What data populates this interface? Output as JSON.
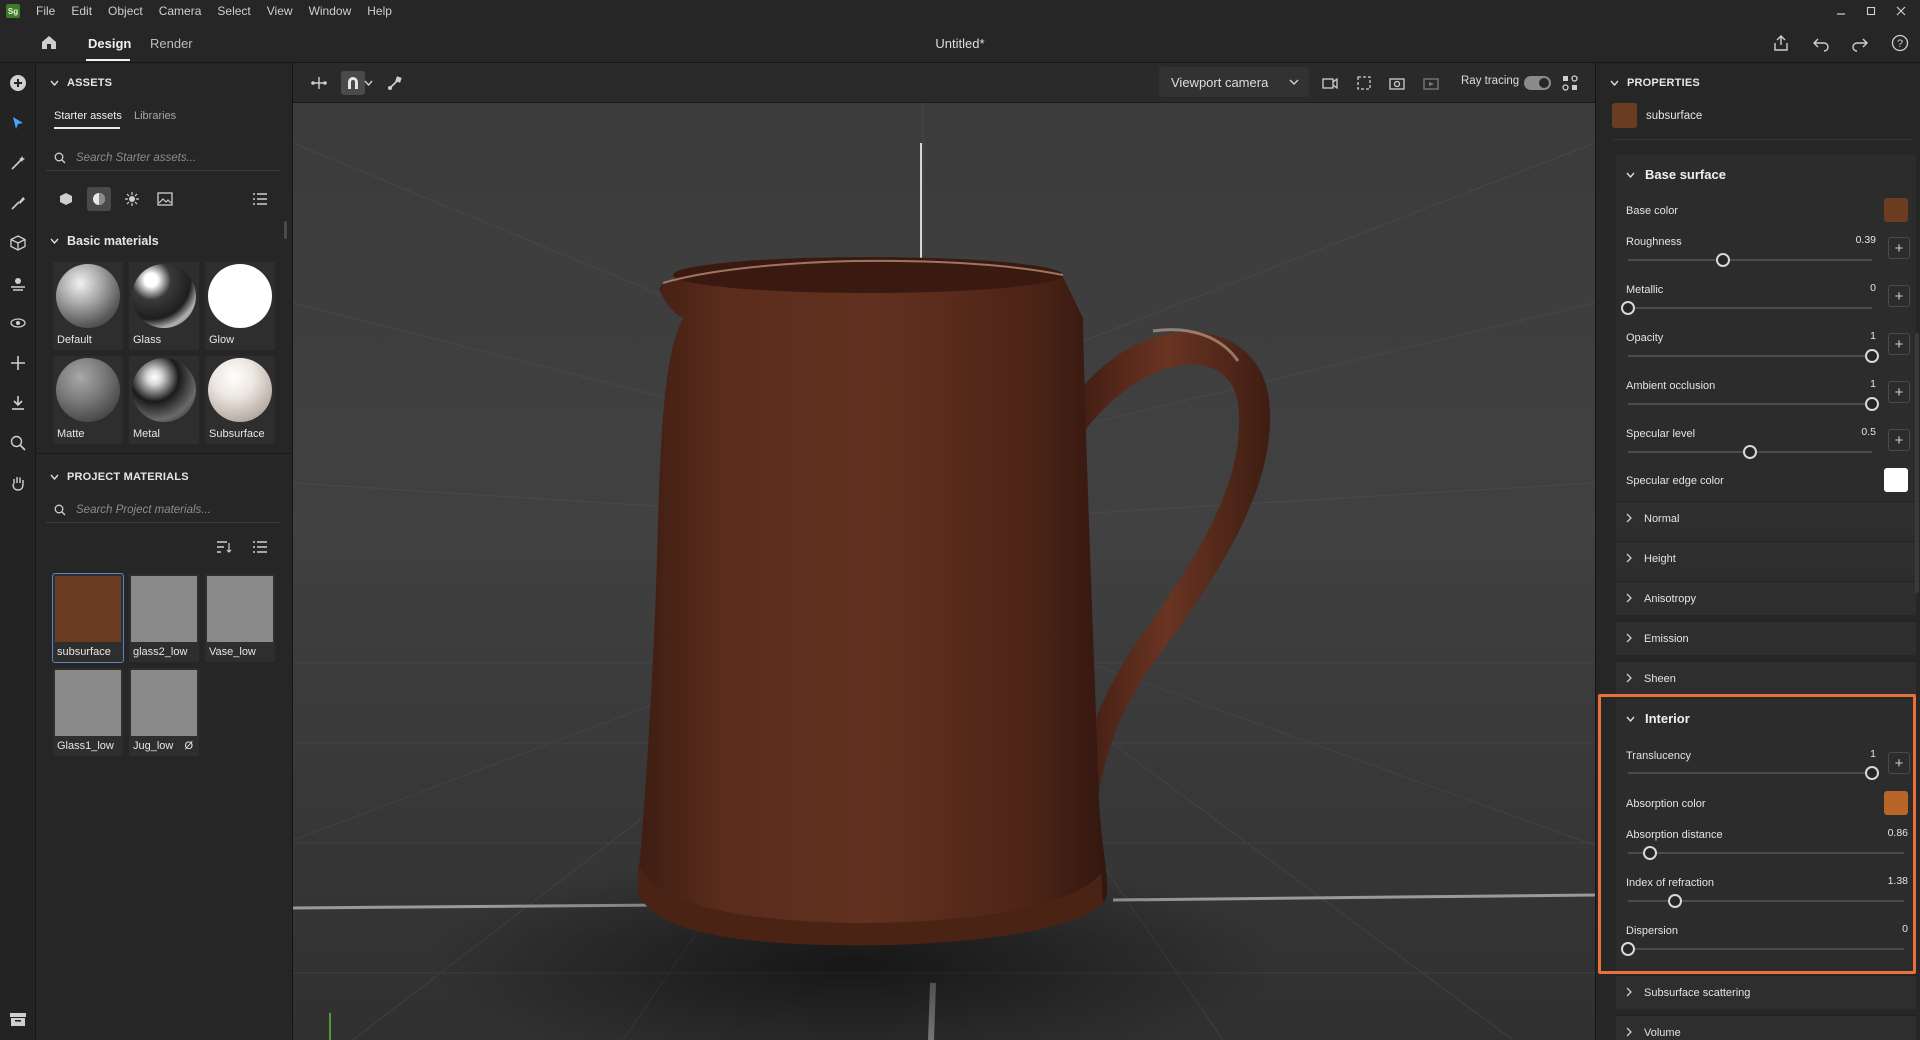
{
  "app": {
    "logo_text": "Sg",
    "title": "Untitled*"
  },
  "menu": [
    "File",
    "Edit",
    "Object",
    "Camera",
    "Select",
    "View",
    "Window",
    "Help"
  ],
  "modes": {
    "design": "Design",
    "render": "Render"
  },
  "assets": {
    "header": "ASSETS",
    "tabs": {
      "starter": "Starter assets",
      "libraries": "Libraries"
    },
    "search_placeholder": "Search Starter assets...",
    "basic_header": "Basic materials",
    "basic_materials": [
      "Default",
      "Glass",
      "Glow",
      "Matte",
      "Metal",
      "Subsurface"
    ]
  },
  "project": {
    "header": "PROJECT MATERIALS",
    "search_placeholder": "Search Project materials...",
    "materials": [
      "subsurface",
      "glass2_low",
      "Vase_low",
      "Glass1_low",
      "Jug_low"
    ],
    "jug_badge": "Ø"
  },
  "viewport": {
    "camera": "Viewport camera",
    "ray_tracing_label": "Ray tracing",
    "ray_tracing_on": true
  },
  "properties": {
    "header": "PROPERTIES",
    "material_name": "subsurface",
    "material_color": "#6a3c22",
    "base_surface": {
      "title": "Base surface",
      "base_color_label": "Base color",
      "base_color": "#6a3c22",
      "roughness": {
        "label": "Roughness",
        "value": "0.39",
        "fraction": 0.39
      },
      "metallic": {
        "label": "Metallic",
        "value": "0",
        "fraction": 0
      },
      "opacity": {
        "label": "Opacity",
        "value": "1",
        "fraction": 1
      },
      "ambient_occlusion": {
        "label": "Ambient occlusion",
        "value": "1",
        "fraction": 1
      },
      "specular_level": {
        "label": "Specular level",
        "value": "0.5",
        "fraction": 0.5
      },
      "specular_edge_color_label": "Specular edge color",
      "specular_edge_color": "#ffffff"
    },
    "collapsed_groups": [
      "Normal",
      "Height",
      "Anisotropy",
      "Emission",
      "Sheen"
    ],
    "interior": {
      "title": "Interior",
      "translucency": {
        "label": "Translucency",
        "value": "1",
        "fraction": 1
      },
      "absorption_color_label": "Absorption color",
      "absorption_color": "#b8652a",
      "absorption_distance": {
        "label": "Absorption distance",
        "value": "0.86",
        "fraction": 0.08
      },
      "index_of_refraction": {
        "label": "Index of refraction",
        "value": "1.38",
        "fraction": 0.17
      },
      "dispersion": {
        "label": "Dispersion",
        "value": "0",
        "fraction": 0
      }
    },
    "trailing_groups": [
      "Subsurface scattering",
      "Volume"
    ]
  },
  "colors": {
    "highlight": "#e8703a",
    "jug": "#5e2f1e"
  }
}
